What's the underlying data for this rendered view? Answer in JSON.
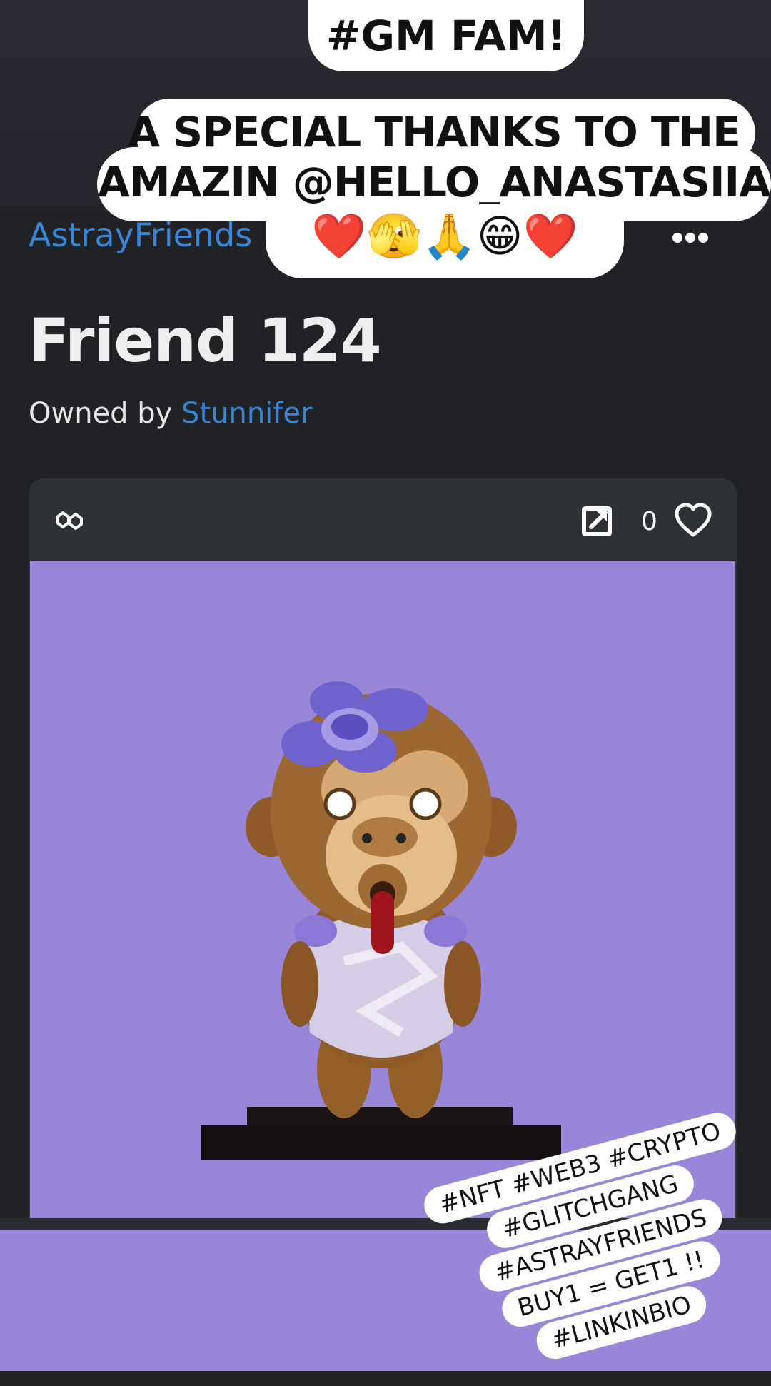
{
  "header": {
    "collection_name": "AstrayFriends",
    "more_icon": "more-horizontal-icon"
  },
  "item": {
    "title": "Friend 124",
    "owned_by_label": "Owned by",
    "owner_name": "Stunnifer"
  },
  "card": {
    "chain_icon": "polygon-chain-icon",
    "open_icon": "open-external-icon",
    "like_count": "0",
    "heart_icon": "heart-outline-icon",
    "image_background": "#9a86d8"
  },
  "stickers": {
    "gm": "#GM FAM!",
    "thanks_line1": "A SPECIAL THANKS TO THE",
    "thanks_line2": "AMAZIN @HELLO_ANASTASIIA",
    "emojis": "❤️🫣🙏😁❤️",
    "hashtag_lines": [
      "#NFT #WEB3 #CRYPTO",
      "#GLITCHGANG",
      "#ASTRAYFRIENDS",
      "BUY1 = GET1 !!",
      "#LINKINBIO"
    ]
  },
  "colors": {
    "accent_link": "#3a86d6",
    "page_bg": "#202225",
    "card_bg": "#2e3136",
    "image_bg": "#9a86d8"
  }
}
